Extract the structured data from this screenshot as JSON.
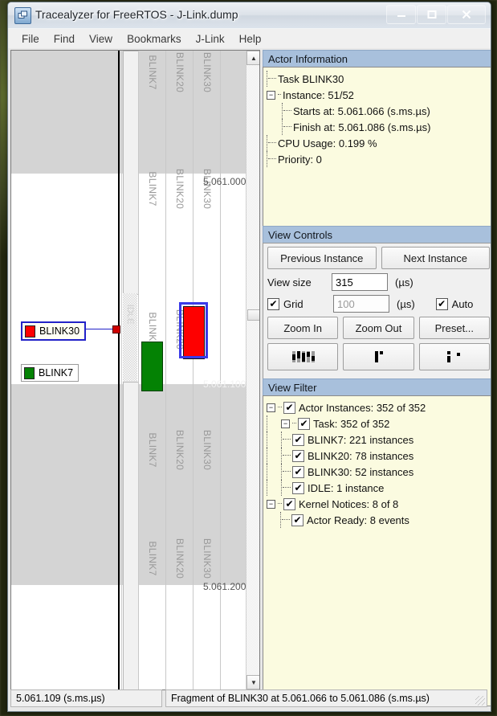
{
  "window": {
    "title": "Tracealyzer for FreeRTOS - J-Link.dump",
    "icon": "app-icon",
    "minimize": "–",
    "maximize": "❐",
    "close": "✕"
  },
  "menu": {
    "items": [
      {
        "label": "File"
      },
      {
        "label": "Find"
      },
      {
        "label": "View"
      },
      {
        "label": "Bookmarks"
      },
      {
        "label": "J-Link"
      },
      {
        "label": "Help"
      }
    ]
  },
  "trace": {
    "columns": [
      "BLINK7",
      "BLINK20",
      "BLINK30"
    ],
    "idle_column": "IDLE",
    "time_labels": [
      "5.061.000",
      "5.061.100",
      "5.061.200"
    ],
    "callouts": [
      {
        "label": "BLINK30",
        "color": "#fe0000",
        "selected": true
      },
      {
        "label": "BLINK7",
        "color": "#048204",
        "selected": false
      }
    ],
    "scroll_up_icon": "▲",
    "scroll_down_icon": "▼"
  },
  "actor_information": {
    "title": "Actor Information",
    "rows": [
      {
        "text": "Task BLINK30",
        "depth": 1,
        "expander": ""
      },
      {
        "text": "Instance: 51/52",
        "depth": 1,
        "expander": "−"
      },
      {
        "text": "Starts at: 5.061.066 (s.ms.µs)",
        "depth": 2,
        "expander": ""
      },
      {
        "text": "Finish at: 5.061.086 (s.ms.µs)",
        "depth": 2,
        "expander": ""
      },
      {
        "text": "CPU Usage: 0.199 %",
        "depth": 1,
        "expander": ""
      },
      {
        "text": "Priority: 0",
        "depth": 1,
        "expander": ""
      }
    ]
  },
  "view_controls": {
    "title": "View Controls",
    "previous_instance": "Previous Instance",
    "next_instance": "Next Instance",
    "view_size_label": "View size",
    "view_size_value": "315",
    "view_size_units": "(µs)",
    "grid_label": "Grid",
    "grid_checked": "✔",
    "grid_value": "100",
    "grid_units": "(µs)",
    "auto_label": "Auto",
    "auto_checked": "✔",
    "zoom_in": "Zoom In",
    "zoom_out": "Zoom Out",
    "preset": "Preset...",
    "density_buttons": [
      {
        "icon": "density-high-icon"
      },
      {
        "icon": "density-medium-icon"
      },
      {
        "icon": "density-low-icon"
      }
    ]
  },
  "view_filter": {
    "title": "View Filter",
    "rows": [
      {
        "text": "Actor Instances: 352 of 352",
        "depth": 0,
        "expander": "−",
        "checked": "✔"
      },
      {
        "text": "Task: 352 of 352",
        "depth": 1,
        "expander": "−",
        "checked": "✔"
      },
      {
        "text": "BLINK7: 221 instances",
        "depth": 2,
        "expander": "",
        "checked": "✔"
      },
      {
        "text": "BLINK20: 78 instances",
        "depth": 2,
        "expander": "",
        "checked": "✔"
      },
      {
        "text": "BLINK30: 52 instances",
        "depth": 2,
        "expander": "",
        "checked": "✔"
      },
      {
        "text": "IDLE: 1 instance",
        "depth": 2,
        "expander": "",
        "checked": "✔"
      },
      {
        "text": "Kernel Notices: 8 of 8",
        "depth": 0,
        "expander": "−",
        "checked": "✔"
      },
      {
        "text": "Actor Ready: 8 events",
        "depth": 1,
        "expander": "",
        "checked": "✔"
      }
    ]
  },
  "status_bar": {
    "cursor_time": "5.061.109 (s.ms.µs)",
    "fragment_info": "Fragment of BLINK30 at 5.061.066 to 5.061.086 (s.ms.µs)"
  },
  "colors": {
    "panel_header": "#a8c0dc",
    "panel_body": "#fbfbe0",
    "blink30": "#fe0000",
    "blink7": "#048204",
    "selection": "#3a3ae8"
  }
}
